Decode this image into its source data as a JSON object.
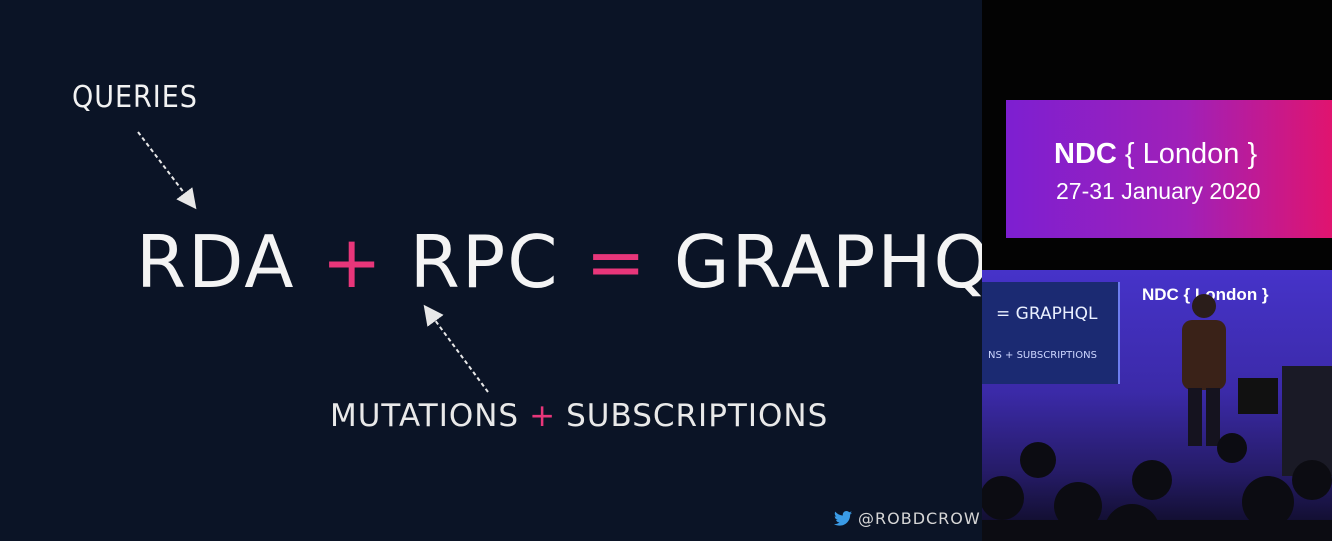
{
  "slide": {
    "queries_label": "QUERIES",
    "formula": {
      "term1": "RDA",
      "plus": "+",
      "term2": "RPC",
      "equals": "=",
      "result": "GRAPHQL"
    },
    "subline": {
      "left": "MUTATIONS",
      "plus": "+",
      "right": "SUBSCRIPTIONS"
    },
    "twitter_handle": "@ROBDCROWLEY"
  },
  "banner": {
    "brand": "NDC",
    "event": "{ London }",
    "dates": "27-31 January 2020"
  },
  "stage": {
    "screen_main": "= GRAPHQL",
    "screen_sub": "NS + SUBSCRIPTIONS",
    "sign": "NDC { London }"
  },
  "colors": {
    "slide_bg": "#0b1426",
    "accent": "#e8367a",
    "banner_start": "#7d1fd1",
    "banner_end": "#e0146f"
  }
}
